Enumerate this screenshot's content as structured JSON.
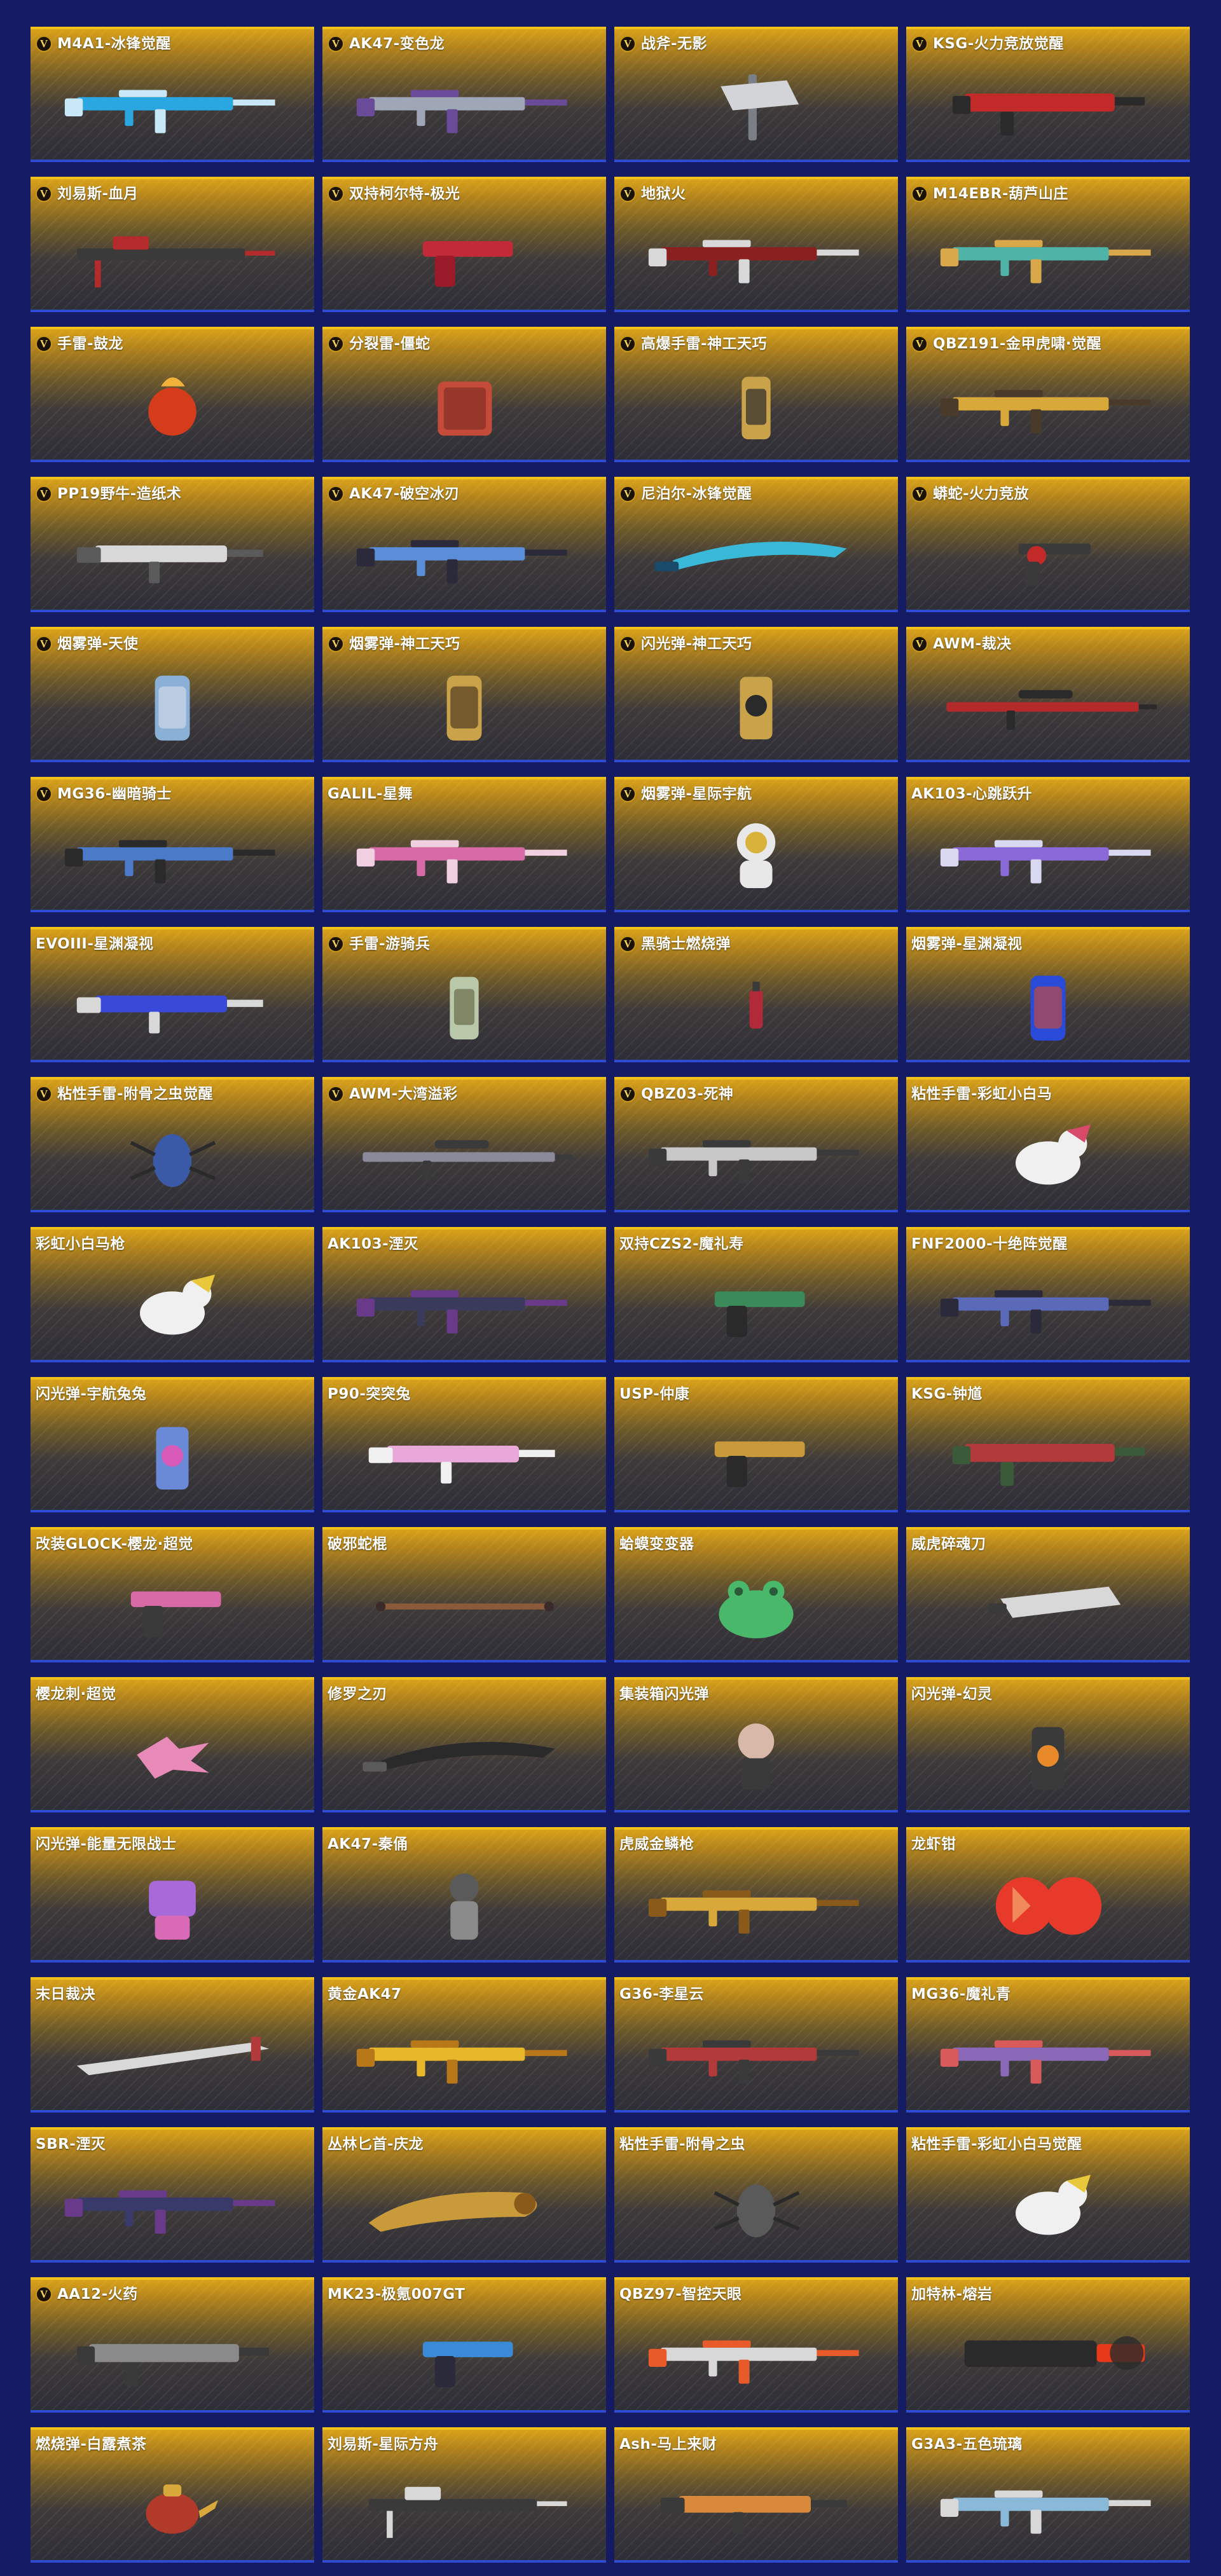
{
  "page": {
    "background": "#141b63",
    "card_top_color": "#d9a21a",
    "card_bottom_color": "#2e2e37",
    "card_border_top": "#f0c21a",
    "card_border_bottom": "#2f4bd3",
    "badge_letter": "V"
  },
  "items": [
    {
      "name": "M4A1-冰锋觉醒",
      "v": true,
      "icon": "rifle-icon",
      "palette": [
        "#2aa6e0",
        "#c8e8f8"
      ]
    },
    {
      "name": "AK47-变色龙",
      "v": true,
      "icon": "rifle-icon",
      "palette": [
        "#9fa6b6",
        "#6a4b9a"
      ]
    },
    {
      "name": "战斧-无影",
      "v": true,
      "icon": "axe-icon",
      "palette": [
        "#d2d4d8",
        "#7a7f88"
      ]
    },
    {
      "name": "KSG-火力竞放觉醒",
      "v": true,
      "icon": "shotgun-icon",
      "palette": [
        "#c22a2a",
        "#2a2a2a"
      ]
    },
    {
      "name": "刘易斯-血月",
      "v": true,
      "icon": "machinegun-icon",
      "palette": [
        "#b52a2a",
        "#3a3a3a"
      ]
    },
    {
      "name": "双持柯尔特-极光",
      "v": true,
      "icon": "pistol-icon",
      "palette": [
        "#c22a3a",
        "#9a1a2a"
      ]
    },
    {
      "name": "地狱火",
      "v": true,
      "icon": "rifle-icon",
      "palette": [
        "#8a2020",
        "#d8d8d8"
      ]
    },
    {
      "name": "M14EBR-葫芦山庄",
      "v": true,
      "icon": "rifle-icon",
      "palette": [
        "#4fb3a8",
        "#d8a84a"
      ]
    },
    {
      "name": "手雷-鼓龙",
      "v": true,
      "icon": "grenade-icon",
      "palette": [
        "#d43c1c",
        "#f2b23a"
      ]
    },
    {
      "name": "分裂雷-僵蛇",
      "v": true,
      "icon": "grenade-box-icon",
      "palette": [
        "#c44a3a",
        "#7a2a22"
      ]
    },
    {
      "name": "高爆手雷-神工天巧",
      "v": true,
      "icon": "grenade-canister-icon",
      "palette": [
        "#caa24a",
        "#2a2a2a"
      ]
    },
    {
      "name": "QBZ191-金甲虎啸·觉醒",
      "v": true,
      "icon": "rifle-icon",
      "palette": [
        "#d8a83a",
        "#4a3a2a"
      ]
    },
    {
      "name": "PP19野牛-造纸术",
      "v": true,
      "icon": "smg-icon",
      "palette": [
        "#d8d8d8",
        "#5a5a5a"
      ]
    },
    {
      "name": "AK47-破空冰刃",
      "v": true,
      "icon": "rifle-icon",
      "palette": [
        "#5a8ed8",
        "#2a2a3a"
      ]
    },
    {
      "name": "尼泊尔-冰锋觉醒",
      "v": true,
      "icon": "knife-icon",
      "palette": [
        "#3ab8d8",
        "#1a4a6a"
      ]
    },
    {
      "name": "蟒蛇-火力竞放",
      "v": true,
      "icon": "revolver-icon",
      "palette": [
        "#3a3a3a",
        "#c22a2a"
      ]
    },
    {
      "name": "烟雾弹-天使",
      "v": true,
      "icon": "smoke-grenade-icon",
      "palette": [
        "#8ab0d8",
        "#d8e0ea"
      ]
    },
    {
      "name": "烟雾弹-神工天巧",
      "v": true,
      "icon": "smoke-grenade-icon",
      "palette": [
        "#caa24a",
        "#3a2a1a"
      ]
    },
    {
      "name": "闪光弹-神工天巧",
      "v": true,
      "icon": "flash-grenade-icon",
      "palette": [
        "#caa24a",
        "#2a2a2a"
      ]
    },
    {
      "name": "AWM-裁决",
      "v": true,
      "icon": "sniper-icon",
      "palette": [
        "#b22a2a",
        "#2a2a2a"
      ]
    },
    {
      "name": "MG36-幽暗骑士",
      "v": true,
      "icon": "rifle-icon",
      "palette": [
        "#4a7ac8",
        "#2a2a2a"
      ]
    },
    {
      "name": "GALIL-星舞",
      "v": false,
      "icon": "rifle-icon",
      "palette": [
        "#d86aa8",
        "#f0d0e0"
      ]
    },
    {
      "name": "烟雾弹-星际宇航",
      "v": true,
      "icon": "astronaut-icon",
      "palette": [
        "#e8e8e8",
        "#d8b23a"
      ]
    },
    {
      "name": "AK103-心跳跃升",
      "v": false,
      "icon": "rifle-icon",
      "palette": [
        "#8a6ad8",
        "#d8d8f0"
      ]
    },
    {
      "name": "EVOIII-星渊凝视",
      "v": false,
      "icon": "smg-icon",
      "palette": [
        "#3a4ad8",
        "#d8d8d8"
      ]
    },
    {
      "name": "手雷-游骑兵",
      "v": true,
      "icon": "grenade-canister-icon",
      "palette": [
        "#b8c8a8",
        "#6a6a4a"
      ]
    },
    {
      "name": "黑骑士燃烧弹",
      "v": true,
      "icon": "molotov-icon",
      "palette": [
        "#b22a3a",
        "#3a3a3a"
      ]
    },
    {
      "name": "烟雾弹-星渊凝视",
      "v": false,
      "icon": "smoke-grenade-icon",
      "palette": [
        "#2a4ad8",
        "#d84a2a"
      ]
    },
    {
      "name": "粘性手雷-附骨之虫觉醒",
      "v": true,
      "icon": "bug-grenade-icon",
      "palette": [
        "#3a5aa8",
        "#2a2a2a"
      ]
    },
    {
      "name": "AWM-大湾溢彩",
      "v": true,
      "icon": "sniper-icon",
      "palette": [
        "#8a8a9a",
        "#3a3a3a"
      ]
    },
    {
      "name": "QBZ03-死神",
      "v": true,
      "icon": "rifle-icon",
      "palette": [
        "#c8c8c8",
        "#3a3a3a"
      ]
    },
    {
      "name": "粘性手雷-彩虹小白马",
      "v": false,
      "icon": "pony-icon",
      "palette": [
        "#f0f0f0",
        "#d84a6a"
      ]
    },
    {
      "name": "彩虹小白马枪",
      "v": false,
      "icon": "pony-icon",
      "palette": [
        "#f0f0f0",
        "#e8c83a"
      ]
    },
    {
      "name": "AK103-湮灭",
      "v": false,
      "icon": "rifle-icon",
      "palette": [
        "#3a3a5a",
        "#6a3a8a"
      ]
    },
    {
      "name": "双持CZS2-魔礼寿",
      "v": false,
      "icon": "pistol-icon",
      "palette": [
        "#3a8a5a",
        "#2a2a2a"
      ]
    },
    {
      "name": "FNF2000-十绝阵觉醒",
      "v": false,
      "icon": "rifle-icon",
      "palette": [
        "#5a6ab8",
        "#2a2a3a"
      ]
    },
    {
      "name": "闪光弹-宇航兔兔",
      "v": false,
      "icon": "flash-grenade-icon",
      "palette": [
        "#6a8ad8",
        "#d85ab8"
      ]
    },
    {
      "name": "P90-突突兔",
      "v": false,
      "icon": "smg-icon",
      "palette": [
        "#e8a8d8",
        "#f0f0f0"
      ]
    },
    {
      "name": "USP-仲康",
      "v": false,
      "icon": "pistol-icon",
      "palette": [
        "#c89a3a",
        "#2a2a2a"
      ]
    },
    {
      "name": "KSG-钟馗",
      "v": false,
      "icon": "shotgun-icon",
      "palette": [
        "#b23a3a",
        "#3a5a3a"
      ]
    },
    {
      "name": "改装GLOCK-樱龙·超觉",
      "v": false,
      "icon": "pistol-icon",
      "palette": [
        "#d86aa8",
        "#3a3a3a"
      ]
    },
    {
      "name": "破邪蛇棍",
      "v": false,
      "icon": "staff-icon",
      "palette": [
        "#8a5a3a",
        "#3a2a2a"
      ]
    },
    {
      "name": "蛤蟆变变器",
      "v": false,
      "icon": "frog-icon",
      "palette": [
        "#4ab86a",
        "#2a5a3a"
      ]
    },
    {
      "name": "威虎碎魂刀",
      "v": false,
      "icon": "blade-icon",
      "palette": [
        "#d8d8d8",
        "#3a3a3a"
      ]
    },
    {
      "name": "樱龙刺·超觉",
      "v": false,
      "icon": "claw-icon",
      "palette": [
        "#e88ab8",
        "#f0d0e0"
      ]
    },
    {
      "name": "修罗之刃",
      "v": false,
      "icon": "knife-icon",
      "palette": [
        "#2a2a2a",
        "#5a5a5a"
      ]
    },
    {
      "name": "集装箱闪光弹",
      "v": false,
      "icon": "doll-icon",
      "palette": [
        "#d8b8a8",
        "#3a3a3a"
      ]
    },
    {
      "name": "闪光弹-幻灵",
      "v": false,
      "icon": "flash-grenade-icon",
      "palette": [
        "#3a3a3a",
        "#e88a2a"
      ]
    },
    {
      "name": "闪光弹-能量无限战士",
      "v": false,
      "icon": "robot-icon",
      "palette": [
        "#a86ad8",
        "#d86ab8"
      ]
    },
    {
      "name": "AK47-秦俑",
      "v": false,
      "icon": "statue-icon",
      "palette": [
        "#5a5a5a",
        "#8a8a8a"
      ]
    },
    {
      "name": "虎威金鳞枪",
      "v": false,
      "icon": "rifle-icon",
      "palette": [
        "#d8a83a",
        "#8a5a1a"
      ]
    },
    {
      "name": "龙虾钳",
      "v": false,
      "icon": "claw-glove-icon",
      "palette": [
        "#e83a2a",
        "#f08a5a"
      ]
    },
    {
      "name": "末日裁决",
      "v": false,
      "icon": "greatsword-icon",
      "palette": [
        "#d8d8d8",
        "#b23a3a"
      ]
    },
    {
      "name": "黄金AK47",
      "v": false,
      "icon": "rifle-icon",
      "palette": [
        "#e8b82a",
        "#b8781a"
      ]
    },
    {
      "name": "G36-李星云",
      "v": false,
      "icon": "rifle-icon",
      "palette": [
        "#b23a3a",
        "#3a3a3a"
      ]
    },
    {
      "name": "MG36-魔礼青",
      "v": false,
      "icon": "rifle-icon",
      "palette": [
        "#8a6ab8",
        "#d85a5a"
      ]
    },
    {
      "name": "SBR-湮灭",
      "v": false,
      "icon": "rifle-icon",
      "palette": [
        "#3a3a6a",
        "#6a3a8a"
      ]
    },
    {
      "name": "丛林匕首-庆龙",
      "v": false,
      "icon": "dragon-knife-icon",
      "palette": [
        "#c89a3a",
        "#8a5a1a"
      ]
    },
    {
      "name": "粘性手雷-附骨之虫",
      "v": false,
      "icon": "bug-grenade-icon",
      "palette": [
        "#5a5a5a",
        "#2a2a2a"
      ]
    },
    {
      "name": "粘性手雷-彩虹小白马觉醒",
      "v": false,
      "icon": "pony-icon",
      "palette": [
        "#f0f0f0",
        "#e8c83a"
      ]
    },
    {
      "name": "AA12-火药",
      "v": true,
      "icon": "shotgun-icon",
      "palette": [
        "#8a8a8a",
        "#3a3a3a"
      ]
    },
    {
      "name": "MK23-极氪007GT",
      "v": false,
      "icon": "pistol-icon",
      "palette": [
        "#3a8ad8",
        "#2a2a3a"
      ]
    },
    {
      "name": "QBZ97-智控天眼",
      "v": false,
      "icon": "rifle-icon",
      "palette": [
        "#d8d8d8",
        "#e85a2a"
      ]
    },
    {
      "name": "加特林-熔岩",
      "v": false,
      "icon": "gatling-icon",
      "palette": [
        "#2a2a2a",
        "#e83a1a"
      ]
    },
    {
      "name": "燃烧弹-白露煮茶",
      "v": false,
      "icon": "teapot-icon",
      "palette": [
        "#b23a2a",
        "#d8a83a"
      ]
    },
    {
      "name": "刘易斯-星际方舟",
      "v": false,
      "icon": "machinegun-icon",
      "palette": [
        "#d8d8d8",
        "#3a3a3a"
      ]
    },
    {
      "name": "Ash-马上来财",
      "v": false,
      "icon": "smg-icon",
      "palette": [
        "#d88a3a",
        "#3a3a3a"
      ]
    },
    {
      "name": "G3A3-五色琉璃",
      "v": false,
      "icon": "rifle-icon",
      "palette": [
        "#8ab8d8",
        "#d8d8d8"
      ]
    }
  ]
}
